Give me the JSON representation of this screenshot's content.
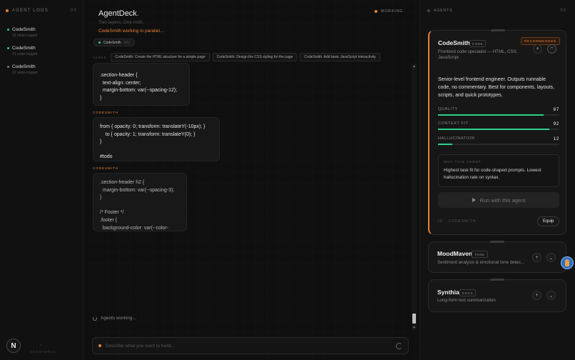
{
  "left": {
    "header": "AGENT LOGS",
    "count": "03",
    "logs": [
      {
        "name": "CodeSmith",
        "sub": "33 steps logged"
      },
      {
        "name": "CodeSmith",
        "sub": "31 steps logged"
      },
      {
        "name": "CodeSmith",
        "sub": "22 steps logged"
      }
    ],
    "logo": "N",
    "footer": "AGENTDECK"
  },
  "main": {
    "title": "AgentDeck",
    "title_dot": ".",
    "tagline": "Two layers. One truth.",
    "working_text": "CodeSmith working in parallel...",
    "chip": {
      "name": "CodeSmith",
      "time": "60s"
    },
    "status": "WORKING",
    "tasks_label": "TASKS",
    "tasks": [
      "CodeSmith: Create the HTML structure for a simple page",
      "CodeSmith: Design the CSS styling for the page",
      "CodeSmith: Add basic JavaScript interactivity"
    ],
    "messages": [
      {
        "text": ".section-header {\n  text-align: center;\n  margin-bottom: var(--spacing-12);\n}"
      },
      {
        "agent": "CODESMITH",
        "text": "from { opacity: 0; transform: translateY(-10px); }\n    to { opacity: 1; transform: translateY(0); }\n}\n\n#todo"
      },
      {
        "agent": "CODESMITH",
        "text": ".section-header h2 {\n  margin-bottom: var(--spacing-3);\n}\n\n/* Footer */\n.footer {\n  background-color: var(--color-"
      }
    ],
    "agents_working": "Agents working...",
    "composer_placeholder": "Describe what you want to build..."
  },
  "right": {
    "header": "AGENTS",
    "count": "03",
    "cards": [
      {
        "name": "CodeSmith",
        "badge": "CODE",
        "recommended": "RECOMMENDED",
        "desc": "Frontend code specialist — HTML, CSS, JavaScript",
        "long": "Senior-level frontend engineer. Outputs runnable code, no commentary. Best for components, layouts, scripts, and quick prototypes.",
        "metrics": [
          {
            "label": "QUALITY",
            "value": "87",
            "pct": 0.87
          },
          {
            "label": "CONTEXT FIT",
            "value": "92",
            "pct": 0.92
          },
          {
            "label": "HALLUCINATION",
            "value": "12",
            "pct": 0.12
          }
        ],
        "why_head": "WHY THIS AGENT",
        "why_text": "Highest task fit for code-shaped prompts. Lowest hallucination rate on syntax.",
        "run": "Run with this agent",
        "id": "ID · CODESMITH",
        "equip": "Equip"
      },
      {
        "name": "MoodMaven",
        "badge": "TONE",
        "desc": "Sentiment analysis & emotional tone detec..."
      },
      {
        "name": "Synthia",
        "badge": "DOCS",
        "desc": "Long-form text summarization"
      }
    ]
  },
  "colors": {
    "accent": "#e8823a",
    "green": "#2fd08a"
  }
}
